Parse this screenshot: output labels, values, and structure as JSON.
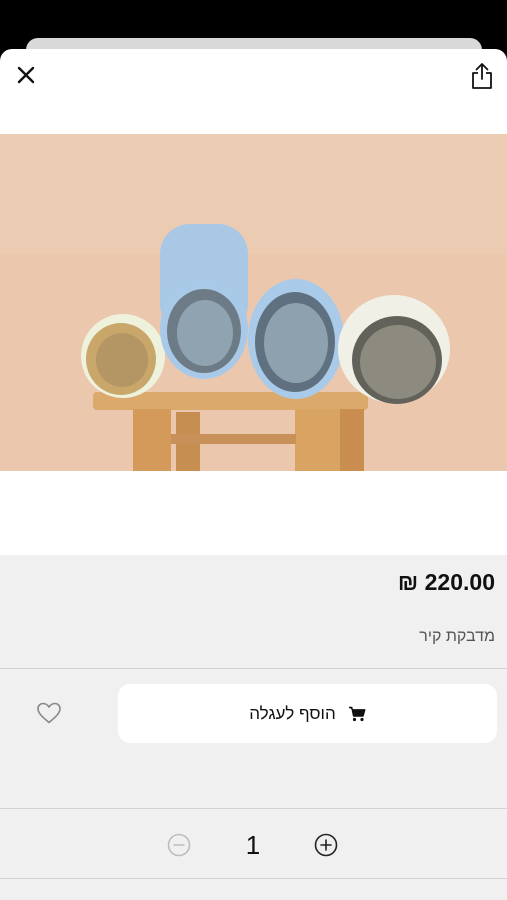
{
  "product": {
    "price": "220.00 ₪",
    "name": "מדבקת קיר",
    "image_alt": "rolls-of-wallpaper-on-stool"
  },
  "actions": {
    "add_to_cart_label": "הוסף לעגלה"
  },
  "quantity": {
    "value": "1"
  },
  "icons": {
    "close": "close-icon",
    "share": "share-icon",
    "cart": "cart-icon",
    "heart": "heart-icon",
    "minus": "minus-circle-icon",
    "plus": "plus-circle-icon"
  },
  "colors": {
    "sheet_bg": "#ffffff",
    "info_bg": "#f0f0f0",
    "button_bg": "#ffffff",
    "text": "#111111"
  }
}
